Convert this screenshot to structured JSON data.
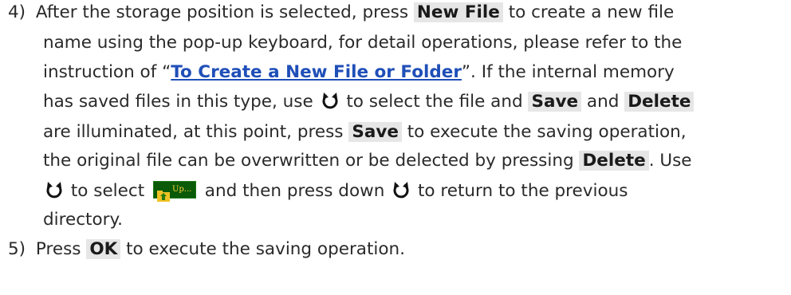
{
  "step4": {
    "number": "4)",
    "l1_a": "After the storage position is selected, press ",
    "l1_b": "New File",
    "l1_c": " to create a new file",
    "l2": "name using the pop-up keyboard, for detail operations, please refer to the",
    "l3_a": "instruction of “",
    "l3_link": "To Create a New File or Folder",
    "l3_c": "”. If the internal memory",
    "l4_a": "has saved files in this type, use ",
    "l4_b": " to select the file and ",
    "l4_save": "Save",
    "l4_and": " and ",
    "l4_delete": "Delete",
    "l5_a": "are illuminated, at this point, press ",
    "l5_save": "Save",
    "l5_c": " to execute the saving operation,",
    "l6_a": "the original file can be overwritten or be delected by pressing ",
    "l6_delete": "Delete",
    "l6_c": ". Use",
    "l7_a": " to select ",
    "l7_up": "Up...",
    "l7_b": " and then press down ",
    "l7_c": " to return to the previous",
    "l8": "directory."
  },
  "step5": {
    "number": "5)",
    "a": "Press ",
    "ok": "OK",
    "b": " to execute the saving operation."
  },
  "icons": {
    "knob": "rotary-knob-icon",
    "folder_up": "folder-up-icon"
  },
  "colors": {
    "link": "#1f4fb8",
    "highlight": "#e6e6e6",
    "up_button_bg": "#0a5a08",
    "up_button_text": "#ffd23a"
  }
}
